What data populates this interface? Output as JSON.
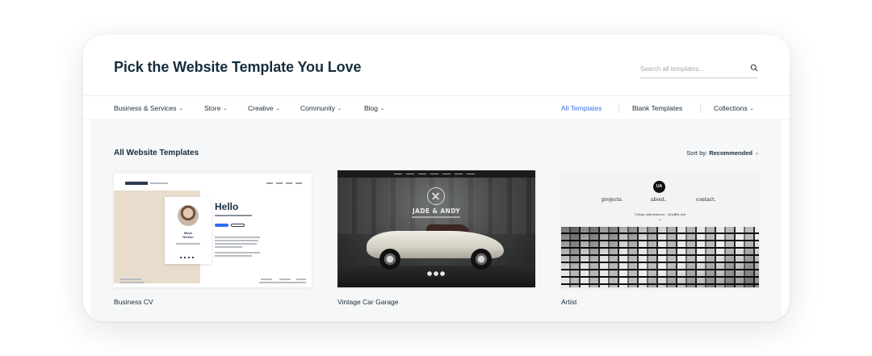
{
  "header": {
    "title": "Pick the Website Template You Love",
    "search_placeholder": "Search all templates..."
  },
  "nav": {
    "left": [
      {
        "label": "Business & Services"
      },
      {
        "label": "Store"
      },
      {
        "label": "Creative"
      },
      {
        "label": "Community"
      },
      {
        "label": "Blog"
      }
    ],
    "right": {
      "all_templates": "All Templates",
      "blank_templates": "Blank Templates",
      "collections": "Collections"
    },
    "active": "All Templates",
    "active_color": "#3b6fe6"
  },
  "gallery": {
    "section_title": "All Website Templates",
    "sort_prefix": "Sort by:",
    "sort_value": "Recommended",
    "templates": [
      {
        "name": "Business CV"
      },
      {
        "name": "Vintage Car Garage"
      },
      {
        "name": "Artist"
      }
    ]
  },
  "thumbnails": {
    "business_cv": {
      "hello": "Hello",
      "name_line1": "Meyo",
      "name_line2": "Nelson"
    },
    "vintage_car": {
      "title": "JADE & ANDY"
    },
    "artist": {
      "logo": "UA",
      "menu": [
        "projects.",
        "about.",
        "contact."
      ],
      "subtitle": "Urban Adventures - Graffiti Art"
    }
  }
}
